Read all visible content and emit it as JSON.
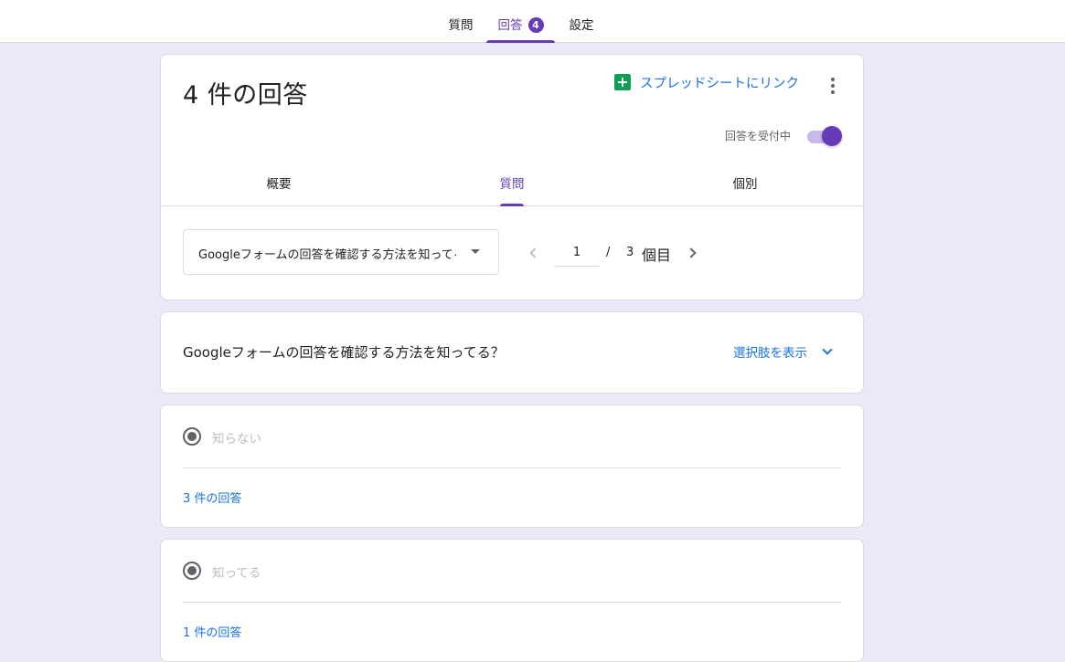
{
  "top_tabs": [
    {
      "label": "質問"
    },
    {
      "label": "回答",
      "badge": "4"
    },
    {
      "label": "設定"
    }
  ],
  "summary_card": {
    "title": "4 件の回答",
    "sheet_link_label": "スプレッドシートにリンク",
    "accepting_label": "回答を受付中",
    "accepting_on": true,
    "subtabs": [
      "概要",
      "質問",
      "個別"
    ],
    "active_subtab": "質問",
    "question_dropdown_value": "Googleフォームの回答を確認する方法を知ってる？",
    "pager": {
      "current": "1",
      "separator": "/",
      "total": "3",
      "suffix": "個目"
    }
  },
  "question_card": {
    "text": "Googleフォームの回答を確認する方法を知ってる？",
    "show_options_label": "選択肢を表示"
  },
  "option_cards": [
    {
      "label": "知らない",
      "count_label": "3 件の回答"
    },
    {
      "label": "知ってる",
      "count_label": "1 件の回答"
    }
  ],
  "colors": {
    "accent": "#673ab7",
    "link": "#1a73e8",
    "background": "#ede8f7",
    "sheets_green": "#0f9d58"
  },
  "icons": [
    "sheets-icon",
    "more-vert-icon",
    "caret-down-icon",
    "chevron-left-icon",
    "chevron-right-icon",
    "expand-more-icon",
    "radio-checked-icon"
  ]
}
